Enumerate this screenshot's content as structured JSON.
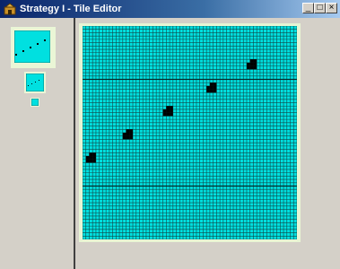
{
  "window": {
    "title": "Strategy I - Tile Editor",
    "icon": "app-icon",
    "controls": {
      "minimize": "_",
      "maximize": "□",
      "close": "×"
    }
  },
  "colors": {
    "title_bar": "#0a246a",
    "window_bg": "#d4d0c8",
    "tile_cyan": "#00e0e0",
    "grid_line": "#104848",
    "frame_bg": "#e8f5d4",
    "pixel_on": "#000000"
  },
  "sidebar": {
    "previews": [
      "preview-large",
      "preview-medium",
      "preview-small"
    ]
  },
  "editor": {
    "grid_cells": 64,
    "filled_blocks": [
      {
        "col": 1,
        "row": 38,
        "cols": 3,
        "rows": 3
      },
      {
        "col": 12,
        "row": 31,
        "cols": 3,
        "rows": 3
      },
      {
        "col": 24,
        "row": 24,
        "cols": 3,
        "rows": 3
      },
      {
        "col": 37,
        "row": 17,
        "cols": 3,
        "rows": 3
      },
      {
        "col": 49,
        "row": 10,
        "cols": 3,
        "rows": 3
      }
    ]
  }
}
